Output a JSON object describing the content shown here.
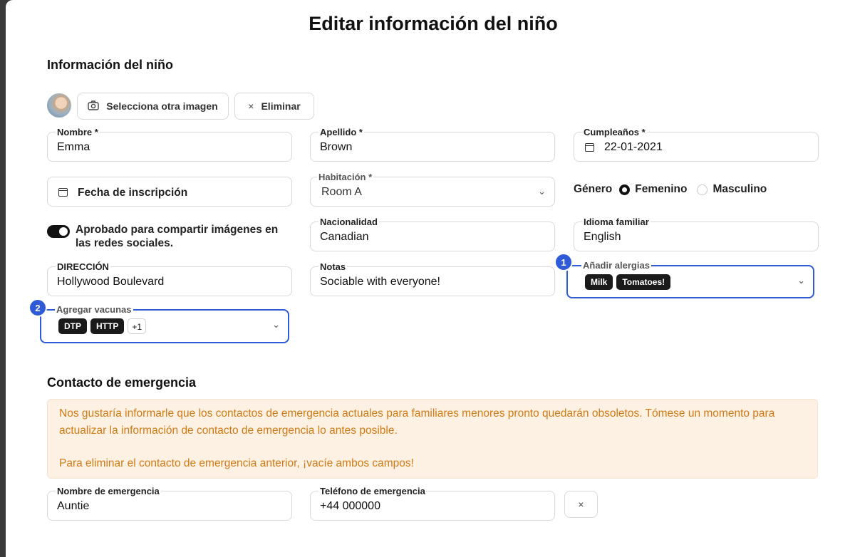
{
  "dialog": {
    "title": "Editar información del niño"
  },
  "child_section": {
    "title": "Información del niño",
    "select_image_label": "Selecciona otra imagen",
    "delete_label": "Eliminar",
    "first_name": {
      "label": "Nombre *",
      "value": "Emma"
    },
    "last_name": {
      "label": "Apellido *",
      "value": "Brown"
    },
    "birthday": {
      "label": "Cumpleaños *",
      "value": "22-01-2021"
    },
    "enrollment_date": {
      "placeholder": "Fecha de inscripción"
    },
    "room": {
      "label": "Habitación *",
      "value": "Room A"
    },
    "gender": {
      "label": "Género",
      "options": [
        "Femenino",
        "Masculino"
      ],
      "selected": "Femenino"
    },
    "social_sharing": {
      "label": "Aprobado para compartir imágenes en las redes sociales.",
      "enabled": true
    },
    "nationality": {
      "label": "Nacionalidad",
      "value": "Canadian"
    },
    "home_language": {
      "label": "Idioma familiar",
      "value": "English"
    },
    "address": {
      "label": "DIRECCIÓN",
      "value": "Hollywood Boulevard"
    },
    "notes": {
      "label": "Notas",
      "value": "Sociable with everyone!"
    },
    "allergies": {
      "label": "Añadir alergias",
      "chips": [
        "Milk",
        "Tomatoes!"
      ],
      "marker": "1"
    },
    "vaccines": {
      "label": "Agregar vacunas",
      "chips": [
        "DTP",
        "HTTP"
      ],
      "more": "+1",
      "marker": "2"
    }
  },
  "emergency_section": {
    "title": "Contacto de emergencia",
    "notice_line1": "Nos gustaría informarle que los contactos de emergencia actuales para familiares menores pronto quedarán obsoletos. Tómese un momento para actualizar la información de contacto de emergencia lo antes posible.",
    "notice_line2": "Para eliminar el contacto de emergencia anterior, ¡vacíe ambos campos!",
    "name": {
      "label": "Nombre de emergencia",
      "value": "Auntie"
    },
    "phone": {
      "label": "Teléfono de emergencia",
      "value": "+44 000000"
    },
    "clear_symbol": "×"
  },
  "icons": {
    "camera": "camera-icon",
    "close": "close-icon",
    "calendar": "calendar-icon",
    "chevron": "chevron-down-icon"
  },
  "colors": {
    "highlight": "#2f5bd6",
    "notice_bg": "#fdf1e3",
    "notice_text": "#d07a15",
    "chip_bg": "#1a1a1a"
  }
}
